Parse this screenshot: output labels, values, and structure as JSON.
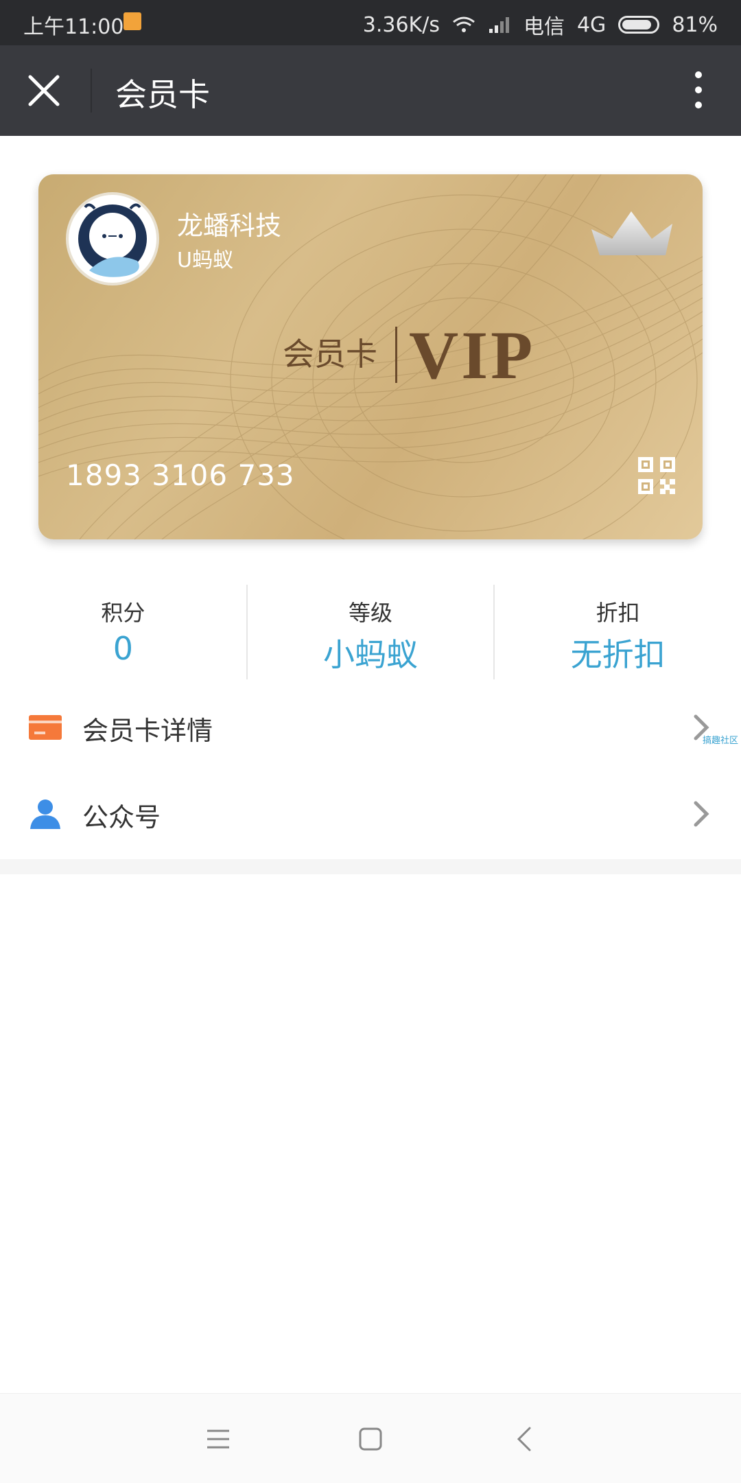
{
  "status_bar": {
    "time": "上午11:00",
    "speed": "3.36K/s",
    "carrier": "电信",
    "network": "4G",
    "battery": "81%",
    "battery_level": 0.81
  },
  "title_bar": {
    "title": "会员卡"
  },
  "card": {
    "brand_name": "龙蟠科技",
    "brand_sub": "U蚂蚁",
    "card_label": "会员卡",
    "vip_text": "VIP",
    "card_number": "1893 3106 733"
  },
  "stats": [
    {
      "label": "积分",
      "value": "0"
    },
    {
      "label": "等级",
      "value": "小蚂蚁"
    },
    {
      "label": "折扣",
      "value": "无折扣"
    }
  ],
  "list": [
    {
      "label": "会员卡详情",
      "icon": "card-icon"
    },
    {
      "label": "公众号",
      "icon": "person-icon"
    }
  ],
  "watermark": "搞趣社区",
  "colors": {
    "accent": "#3aa3d1",
    "title_bar": "#393a3f",
    "status_bar": "#2a2b2e",
    "card_gold": "#d2b47e",
    "card_text": "#6a4a2c",
    "icon_orange": "#f5793a",
    "icon_blue": "#3d8ee6"
  }
}
